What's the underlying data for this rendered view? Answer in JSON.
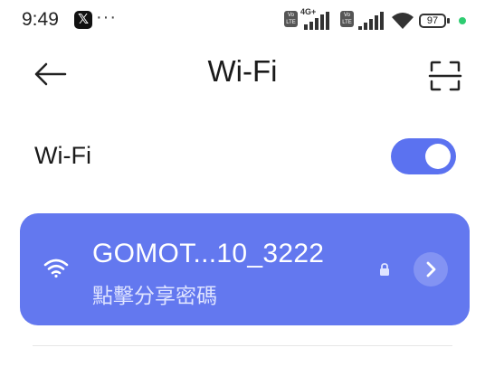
{
  "status_bar": {
    "time": "9:49",
    "app_icon": "x-app-icon",
    "more": "···",
    "network_type": "4G+",
    "volte_1": "Vo LTE",
    "volte_2": "Vo LTE",
    "battery": "97",
    "charge_color": "#2ecc71"
  },
  "header": {
    "title": "Wi-Fi",
    "back_icon": "back-arrow-icon",
    "scan_icon": "qr-scan-icon"
  },
  "wifi_toggle": {
    "label": "Wi-Fi",
    "enabled": true
  },
  "connected_network": {
    "ssid": "GOMOT...10_3222",
    "subtitle": "點擊分享密碼",
    "secured": true,
    "signal_icon": "wifi-signal-icon",
    "detail_icon": "chevron-right-icon"
  },
  "colors": {
    "accent": "#5b72f0",
    "card": "#6378ef",
    "card_button": "#8393f3"
  }
}
